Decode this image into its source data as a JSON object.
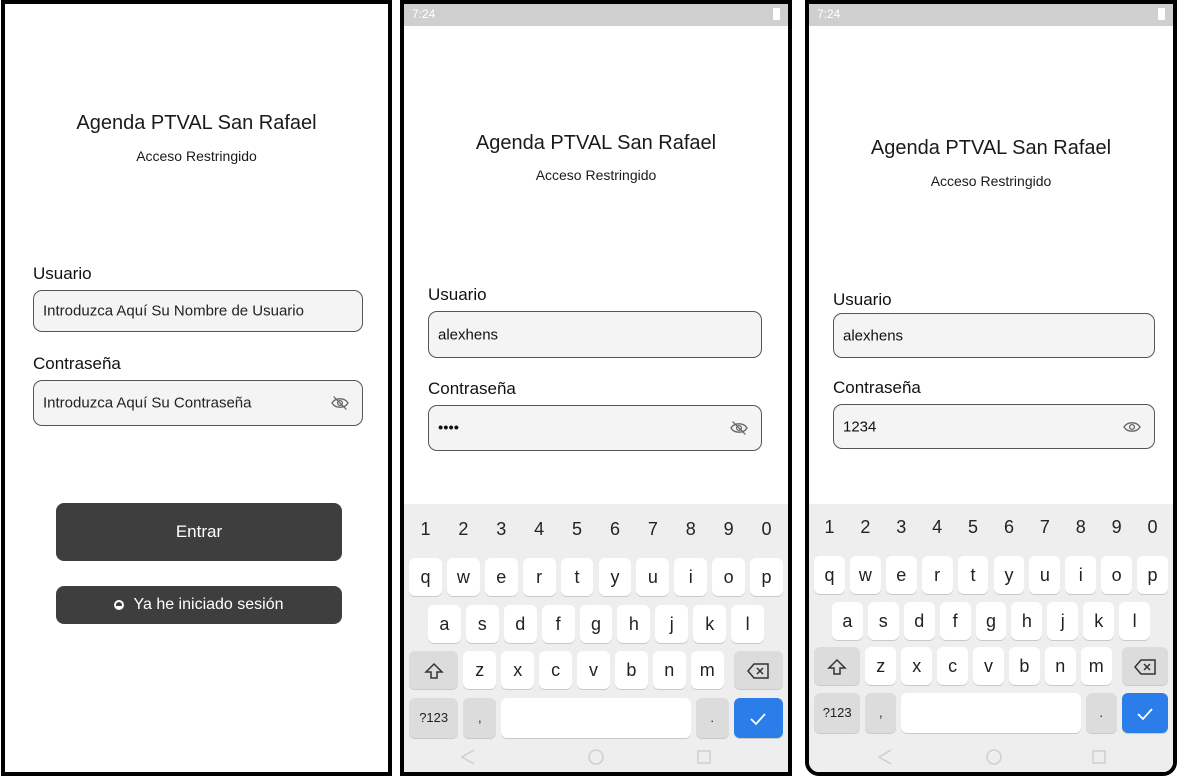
{
  "screens": [
    {
      "id": "p1",
      "title": "Agenda PTVAL San Rafael",
      "subtitle": "Acceso Restringido",
      "user_label": "Usuario",
      "user_value": "Introduzca Aquí Su Nombre de Usuario",
      "pass_label": "Contraseña",
      "pass_value": "Introduzca Aquí Su Contraseña",
      "eye_icon": "eye-off-icon",
      "login_button": "Entrar",
      "session_button": "Ya he iniciado sesión"
    },
    {
      "id": "p2",
      "status_time": "7:24",
      "title": "Agenda PTVAL San Rafael",
      "subtitle": "Acceso Restringido",
      "user_label": "Usuario",
      "user_value": "alexhens",
      "pass_label": "Contraseña",
      "pass_value": "••••",
      "eye_icon": "eye-off-icon"
    },
    {
      "id": "p3",
      "status_time": "7:24",
      "title": "Agenda PTVAL San Rafael",
      "subtitle": "Acceso Restringido",
      "user_label": "Usuario",
      "user_value": "alexhens",
      "pass_label": "Contraseña",
      "pass_value": "1234",
      "eye_icon": "eye-icon"
    }
  ],
  "keyboard": {
    "numbers": [
      "1",
      "2",
      "3",
      "4",
      "5",
      "6",
      "7",
      "8",
      "9",
      "0"
    ],
    "row1": [
      "q",
      "w",
      "e",
      "r",
      "t",
      "y",
      "u",
      "i",
      "o",
      "p"
    ],
    "row2": [
      "a",
      "s",
      "d",
      "f",
      "g",
      "h",
      "j",
      "k",
      "l"
    ],
    "row3": [
      "z",
      "x",
      "c",
      "v",
      "b",
      "n",
      "m"
    ],
    "symbols_key": "?123",
    "comma_key": ",",
    "period_key": "."
  },
  "colors": {
    "button_bg": "#3e3e3e",
    "enter_key": "#2b7de9",
    "status_bar": "#cfcfcf"
  }
}
